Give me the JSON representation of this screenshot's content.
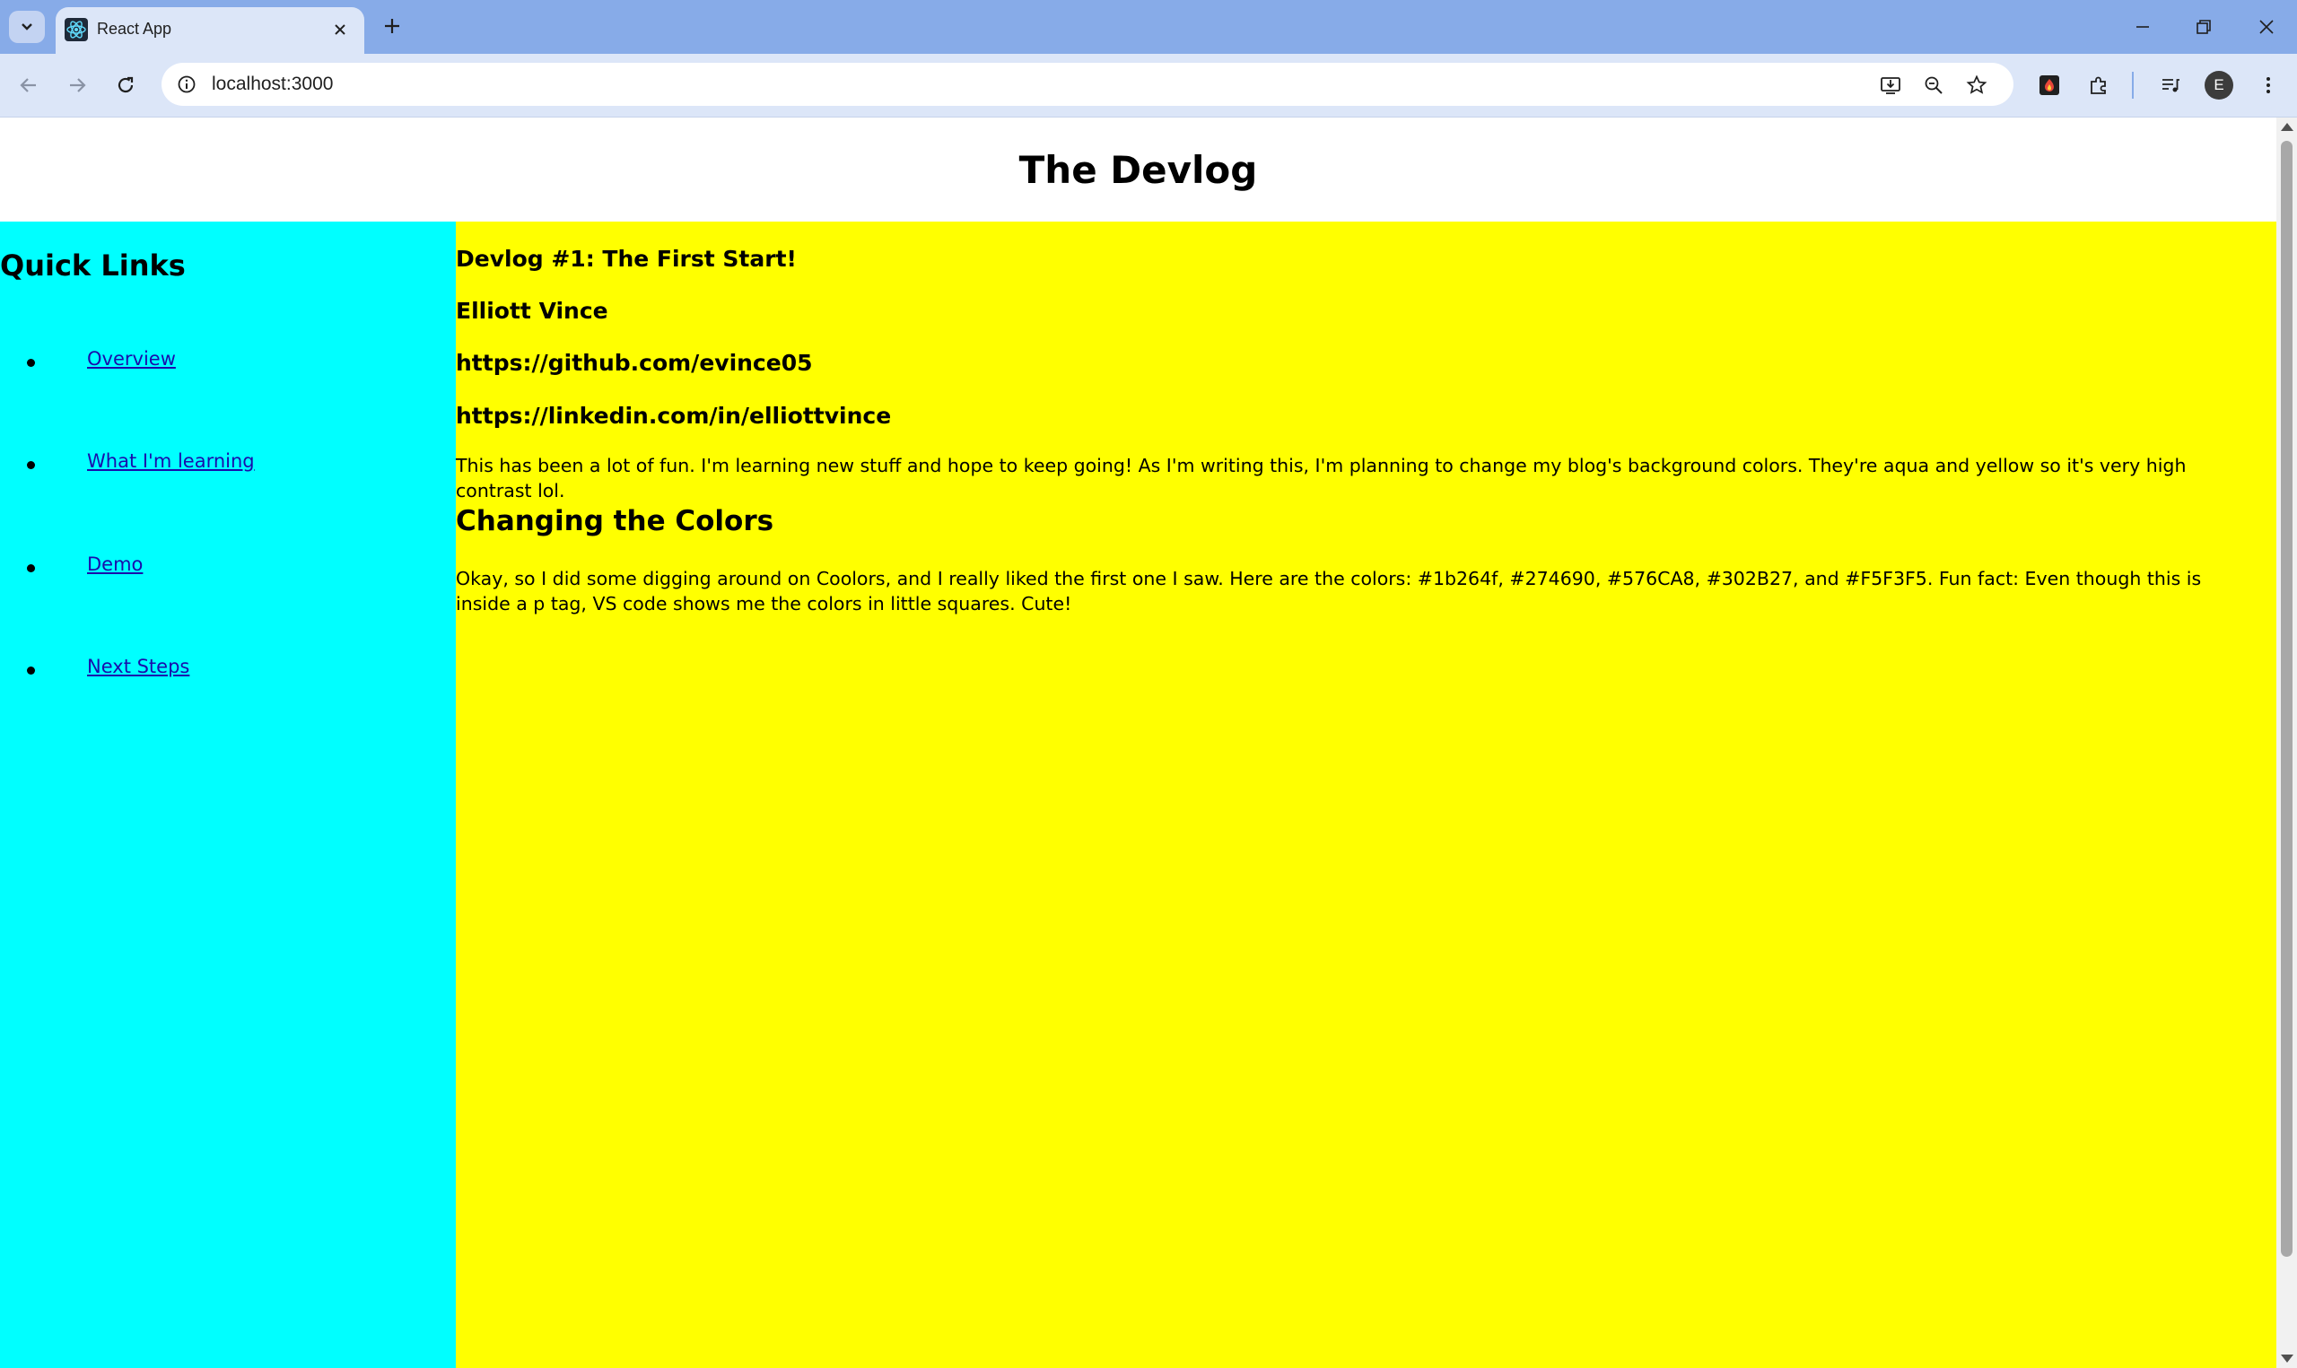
{
  "browser": {
    "tab": {
      "title": "React App"
    },
    "address_bar": {
      "url": "localhost:3000"
    },
    "profile_initial": "E"
  },
  "page": {
    "title": "The Devlog",
    "sidebar": {
      "heading": "Quick Links",
      "links": [
        {
          "label": "Overview"
        },
        {
          "label": "What I'm learning"
        },
        {
          "label": "Demo"
        },
        {
          "label": "Next Steps"
        }
      ]
    },
    "post": {
      "title": "Devlog #1: The First Start!",
      "author": "Elliott Vince",
      "github": "https://github.com/evince05",
      "linkedin": "https://linkedin.com/in/elliottvince",
      "intro": "This has been a lot of fun. I'm learning new stuff and hope to keep going! As I'm writing this, I'm planning to change my blog's background colors. They're aqua and yellow so it's very high contrast lol.",
      "section_heading": "Changing the Colors",
      "section_text": "Okay, so I did some digging around on Coolors, and I really liked the first one I saw. Here are the colors: #1b264f, #274690, #576CA8, #302B27, and #F5F3F5. Fun fact: Even though this is inside a p tag, VS code shows me the colors in little squares. Cute!"
    }
  },
  "colors": {
    "sidebar_background": "#00FFFF",
    "main_background": "#FFFF00",
    "tab_strip": "#87ABE8"
  }
}
